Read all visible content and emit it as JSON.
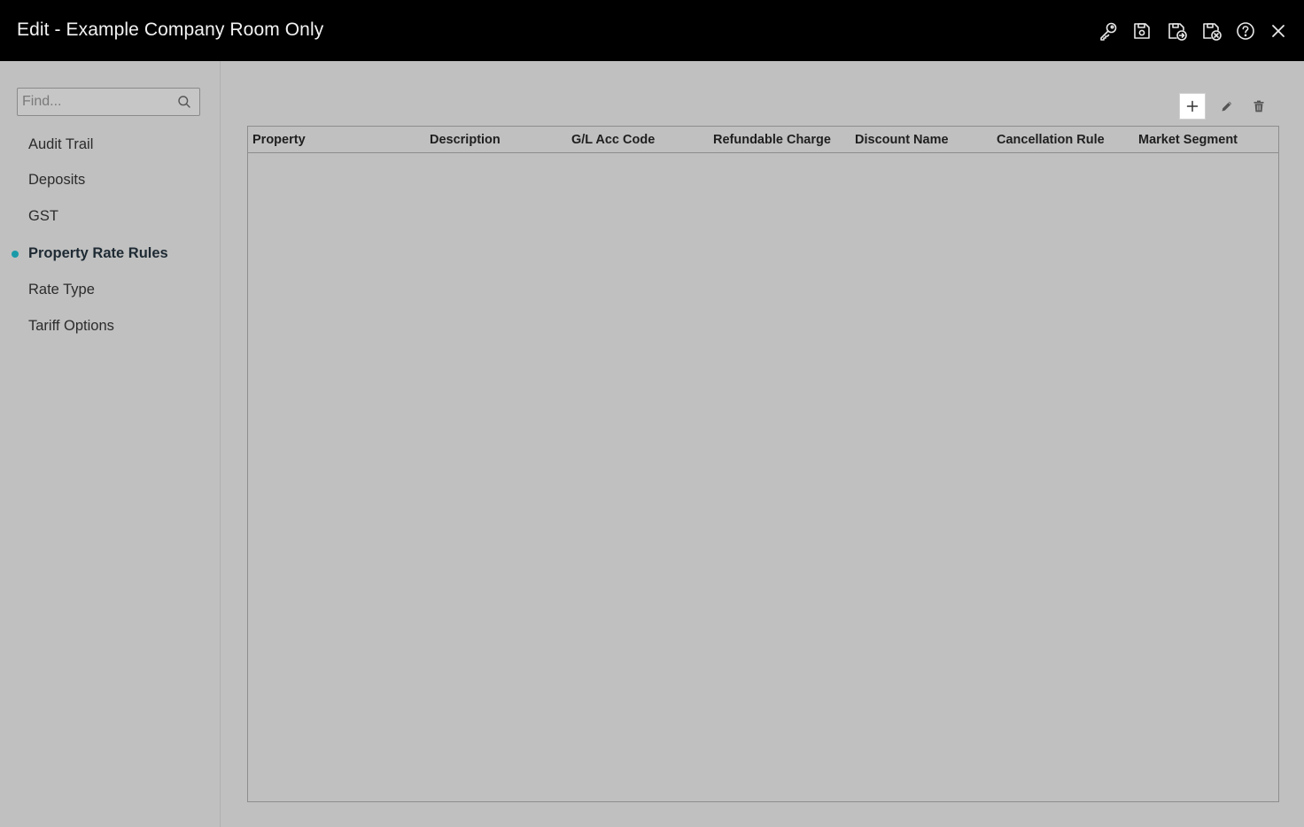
{
  "window": {
    "title": "Edit - Example Company Room Only",
    "toolbar_icons": [
      "key-icon",
      "save-icon",
      "save-and-exit-icon",
      "save-and-close-icon",
      "help-icon",
      "close-icon"
    ]
  },
  "sidebar": {
    "search": {
      "placeholder": "Find...",
      "value": ""
    },
    "items": [
      {
        "label": "Audit Trail",
        "active": false
      },
      {
        "label": "Deposits",
        "active": false
      },
      {
        "label": "GST",
        "active": false
      },
      {
        "label": "Property Rate Rules",
        "active": true
      },
      {
        "label": "Rate Type",
        "active": false
      },
      {
        "label": "Tariff Options",
        "active": false
      }
    ],
    "active_indicator_color": "#1a9aa8"
  },
  "grid": {
    "toolbar_icons": [
      "plus-icon",
      "pencil-icon",
      "trash-icon"
    ],
    "columns": [
      "Property",
      "Description",
      "G/L Acc Code",
      "Refundable Charge",
      "Discount Name",
      "Cancellation Rule",
      "Market Segment"
    ],
    "rows": []
  },
  "colors": {
    "titlebar": "#000000",
    "background": "#c0c0c0",
    "accent": "#1a9aa8"
  }
}
